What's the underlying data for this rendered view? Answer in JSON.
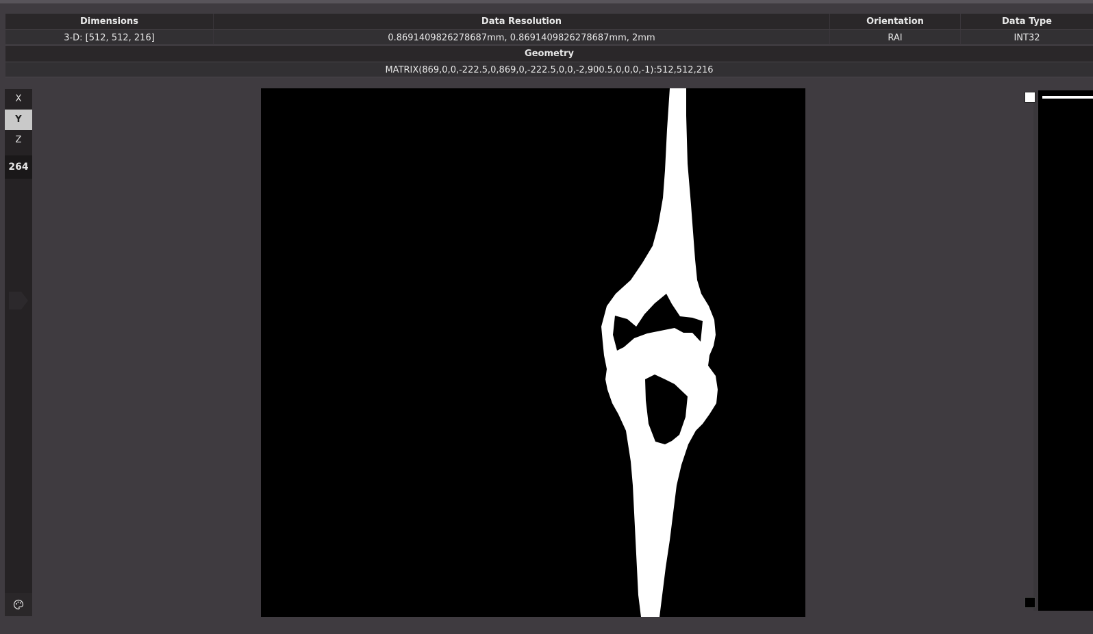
{
  "info": {
    "headers": {
      "dimensions": "Dimensions",
      "resolution": "Data Resolution",
      "orientation": "Orientation",
      "datatype": "Data Type"
    },
    "values": {
      "dimensions": "3-D: [512, 512, 216]",
      "resolution": "0.8691409826278687mm, 0.8691409826278687mm, 2mm",
      "orientation": "RAI",
      "datatype": "INT32"
    },
    "geometry_header": "Geometry",
    "geometry_value": "MATRIX(869,0,0,-222.5,0,869,0,-222.5,0,0,-2,900.5,0,0,0,-1):512,512,216"
  },
  "axis_buttons": [
    "X",
    "Y",
    "Z"
  ],
  "active_axis": "Y",
  "slice_index": "264",
  "icons": {
    "palette": "palette-icon",
    "slider": "slider-handle-icon"
  },
  "colors": {
    "background": "#3f3b40",
    "active_button": "#c9c9c9",
    "mask": "#ffffff",
    "viewport": "#000000"
  }
}
